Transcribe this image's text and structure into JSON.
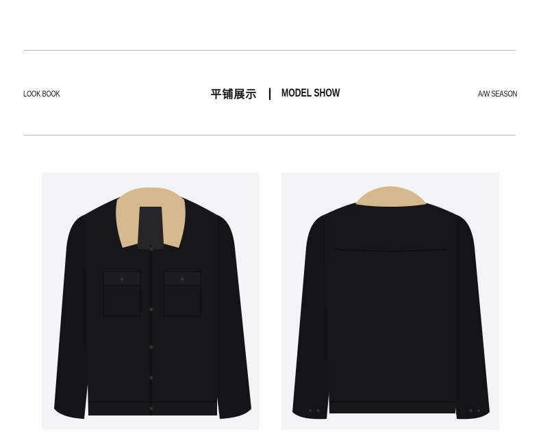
{
  "header": {
    "left_label": "LOOK BOOK",
    "center_cn": "平铺展示",
    "center_separator": "|",
    "center_en": "MODEL SHOW",
    "right_label": "A/W SEASON"
  },
  "colors": {
    "background": "#ffffff",
    "rule": "#bdbdbd",
    "photo_bg": "#f3f4f6",
    "jacket": "#151518",
    "collar": "#d6b88f"
  },
  "photos": [
    {
      "view": "front"
    },
    {
      "view": "back"
    }
  ]
}
